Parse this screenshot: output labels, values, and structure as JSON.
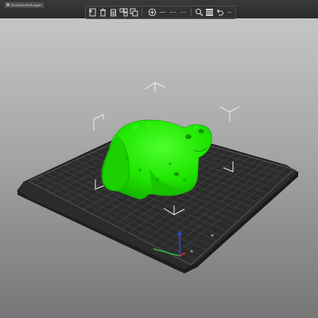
{
  "window": {
    "tab_label": "Druckeinstellungen"
  },
  "toolbar": {
    "buttons": [
      {
        "name": "add-object",
        "icon": "add-file-icon"
      },
      {
        "name": "delete",
        "icon": "trash-icon"
      },
      {
        "name": "delete-all",
        "icon": "trash-all-icon"
      },
      {
        "name": "arrange",
        "icon": "arrange-icon"
      },
      {
        "name": "copy",
        "icon": "copy-icon"
      },
      {
        "name": "paste",
        "icon": "paste-icon"
      },
      {
        "name": "add-instance",
        "icon": "plus-icon"
      },
      {
        "name": "remove-instance",
        "icon": "minus-icon"
      },
      {
        "name": "split-objects",
        "icon": "split-objects-icon"
      },
      {
        "name": "split-parts",
        "icon": "split-parts-icon"
      },
      {
        "name": "search",
        "icon": "search-icon"
      },
      {
        "name": "layer-editing",
        "icon": "layers-icon"
      },
      {
        "name": "undo",
        "icon": "undo-icon"
      },
      {
        "name": "redo",
        "icon": "redo-icon"
      }
    ]
  },
  "scene": {
    "bed_color": "#2c2c2c",
    "grid_color": "#454545",
    "model_color": "#1fe600",
    "axis_colors": {
      "x": "#e03030",
      "y": "#29b84a",
      "z": "#2a4de0"
    }
  }
}
